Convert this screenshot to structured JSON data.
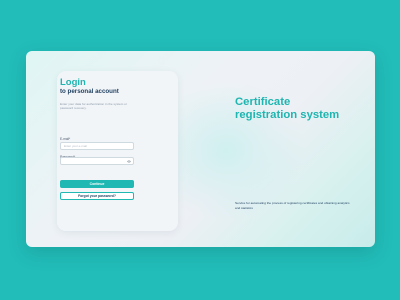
{
  "login": {
    "title": "Login",
    "subtitle": "to personal account",
    "description": "Enter your data for authorization in the system or password recovery.",
    "email_label": "E-mail*",
    "email_placeholder": "Enter your e-mail",
    "password_label": "Password*",
    "password_placeholder": "",
    "continue_label": "Continue",
    "forgot_label": "Forgot your password?"
  },
  "hero": {
    "headline": "Certificate registration system",
    "description": "Service for automating the process of registering certificates and obtaining analytics and statistics"
  },
  "colors": {
    "background": "#22bdb9",
    "accent": "#1fb5b0",
    "text_dark": "#1d3e5e"
  },
  "icons": [
    "eye-icon"
  ]
}
